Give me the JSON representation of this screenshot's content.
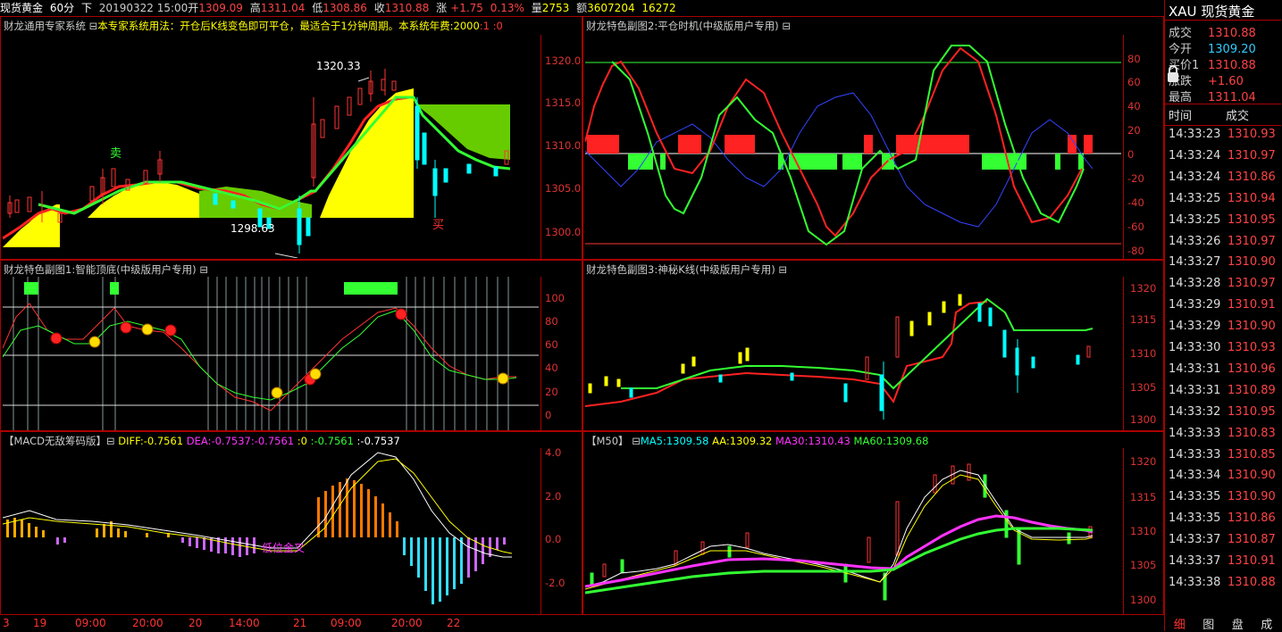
{
  "top": {
    "symbol": "现货黄金",
    "period": "60分",
    "dir": "下",
    "datetime": "20190322 15:00",
    "open_label": "开",
    "open": "1309.09",
    "high_label": "高",
    "high": "1311.04",
    "low_label": "低",
    "low": "1308.86",
    "close_label": "收",
    "close": "1310.88",
    "change_label": "涨",
    "change": "+1.75",
    "pct": "0.13%",
    "vol_label": "量",
    "vol": "2753",
    "amt_label": "额",
    "amt": "3607204",
    "extra": "16272"
  },
  "main": {
    "title": "财龙通用专家系统 ⊟",
    "desc": "本专家系统用法：开仓后K线变色即可平仓，最适合于1分钟周期。本系统年费:2000",
    "flag1": ":1",
    "flag2": ":0",
    "high_note": "1320.33",
    "low_note": "1298.63",
    "sell_label": "卖",
    "buy_label": "买",
    "yticks": [
      "1320.0",
      "1315.0",
      "1310.0",
      "1305.0",
      "1300.0"
    ]
  },
  "sub1": {
    "title": "财龙特色副图1:智能顶底(中级版用户专用) ⊟",
    "yticks": [
      "100",
      "80",
      "60",
      "40",
      "20",
      "0"
    ]
  },
  "sub2": {
    "title": "财龙特色副图2:平仓时机(中级版用户专用) ⊟",
    "yticks": [
      "80",
      "60",
      "40",
      "20",
      "0",
      "-20",
      "-40",
      "-60",
      "-80"
    ]
  },
  "sub3": {
    "title": "财龙特色副图3:神秘K线(中级版用户专用) ⊟",
    "yticks": [
      "1320",
      "1315",
      "1310",
      "1305",
      "1300"
    ]
  },
  "macd": {
    "title": "【MACD无敌筹码版】⊟",
    "diff": "DIFF:-0.7561",
    "dea": "DEA:-0.7537",
    "a": ":-0.7561",
    "b": ":0",
    "c": ":-0.7561",
    "d": ":-0.7537",
    "note": "低位金叉",
    "yticks": [
      "4.0",
      "2.0",
      "0.0",
      "-2.0"
    ]
  },
  "ma": {
    "title": "【M50】 ⊟",
    "ma5": "MA5:1309.58",
    "aa": "AA:1309.32",
    "ma30": "MA30:1310.43",
    "ma60": "MA60:1309.68",
    "yticks": [
      "1320",
      "1315",
      "1310",
      "1305",
      "1300"
    ]
  },
  "xaxis": [
    "3",
    "19",
    "09:00",
    "20:00",
    "20",
    "14:00",
    "21",
    "09:00",
    "20:00",
    "22"
  ],
  "quote": {
    "code": "XAU",
    "name": "现货黄金",
    "rows": [
      {
        "k": "成交",
        "v": "1310.88"
      },
      {
        "k": "今开",
        "v": "1309.20"
      },
      {
        "k": "买价1",
        "v": "1310.88"
      },
      {
        "k": "涨跌",
        "v": "+1.60"
      },
      {
        "k": "最高",
        "v": "1311.04"
      }
    ],
    "col_time": "时间",
    "col_price": "成交"
  },
  "ticks": [
    {
      "t": "14:33:23",
      "p": "1310.93"
    },
    {
      "t": "14:33:24",
      "p": "1310.97"
    },
    {
      "t": "14:33:24",
      "p": "1310.86"
    },
    {
      "t": "14:33:25",
      "p": "1310.94"
    },
    {
      "t": "14:33:25",
      "p": "1310.95"
    },
    {
      "t": "14:33:26",
      "p": "1310.97"
    },
    {
      "t": "14:33:27",
      "p": "1310.90"
    },
    {
      "t": "14:33:28",
      "p": "1310.97"
    },
    {
      "t": "14:33:29",
      "p": "1310.91"
    },
    {
      "t": "14:33:29",
      "p": "1310.90"
    },
    {
      "t": "14:33:30",
      "p": "1310.93"
    },
    {
      "t": "14:33:31",
      "p": "1310.96"
    },
    {
      "t": "14:33:31",
      "p": "1310.89"
    },
    {
      "t": "14:33:32",
      "p": "1310.95"
    },
    {
      "t": "14:33:33",
      "p": "1310.83"
    },
    {
      "t": "14:33:33",
      "p": "1310.85"
    },
    {
      "t": "14:33:34",
      "p": "1310.90"
    },
    {
      "t": "14:33:35",
      "p": "1310.90"
    },
    {
      "t": "14:33:35",
      "p": "1310.86"
    },
    {
      "t": "14:33:37",
      "p": "1310.87"
    },
    {
      "t": "14:33:37",
      "p": "1310.91"
    },
    {
      "t": "14:33:38",
      "p": "1310.88"
    }
  ],
  "tabs": [
    "细",
    "图",
    "盘",
    "成"
  ],
  "colors": {
    "border": "#aa0000",
    "up": "#ff3333",
    "down": "#00ffff",
    "yellow": "#ffff00",
    "green": "#33ff33",
    "magenta": "#ff33ff"
  }
}
